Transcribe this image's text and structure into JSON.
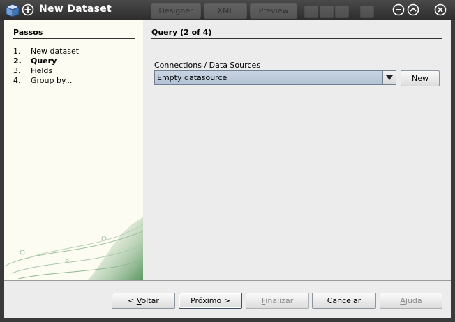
{
  "window": {
    "title": "New Dataset",
    "background_tabs": [
      "Designer",
      "XML",
      "Preview"
    ]
  },
  "sidebar": {
    "header": "Passos",
    "steps": [
      {
        "num": "1.",
        "label": "New dataset",
        "active": false
      },
      {
        "num": "2.",
        "label": "Query",
        "active": true
      },
      {
        "num": "3.",
        "label": "Fields",
        "active": false
      },
      {
        "num": "4.",
        "label": "Group by...",
        "active": false
      }
    ]
  },
  "content": {
    "title": "Query (2 of 4)",
    "connections_label": "Connections / Data Sources",
    "datasource_value": "Empty datasource",
    "new_button": "New"
  },
  "footer": {
    "back": {
      "prefix": "< ",
      "mnemonic": "V",
      "rest": "oltar"
    },
    "next": "Próximo >",
    "finish": {
      "prefix": "",
      "mnemonic": "F",
      "rest": "inalizar",
      "enabled": false
    },
    "cancel": "Cancelar",
    "help": {
      "prefix": "",
      "mnemonic": "A",
      "rest": "juda",
      "enabled": false
    }
  },
  "colors": {
    "combo_selected": "#b8c7d8",
    "sidebar_bg": "#fcfcf2",
    "dialog_bg": "#ececec",
    "deco_green": "#4a8a52"
  }
}
